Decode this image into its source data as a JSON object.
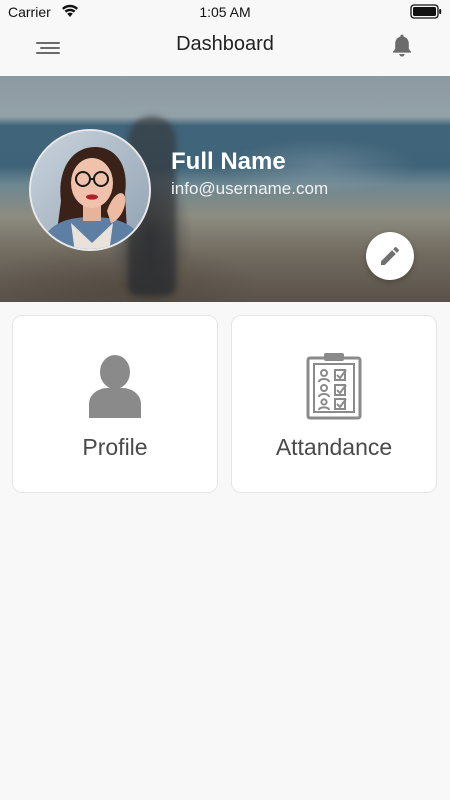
{
  "status_bar": {
    "carrier": "Carrier",
    "time": "1:05 AM",
    "icons": [
      "wifi-icon",
      "battery-icon"
    ]
  },
  "nav": {
    "title": "Dashboard",
    "icons": [
      "menu-icon",
      "bell-icon"
    ]
  },
  "profile_header": {
    "name": "Full Name",
    "email": "info@username.com",
    "icons": [
      "avatar",
      "pencil-icon"
    ]
  },
  "cards": [
    {
      "label": "Profile",
      "icon": "person-icon"
    },
    {
      "label": "Attandance",
      "icon": "clipboard-checklist-icon"
    }
  ],
  "colors": {
    "background": "#f8f8f8",
    "card": "#ffffff",
    "icon_gray": "#8a8a8a",
    "label_gray": "#4a4a4a"
  }
}
